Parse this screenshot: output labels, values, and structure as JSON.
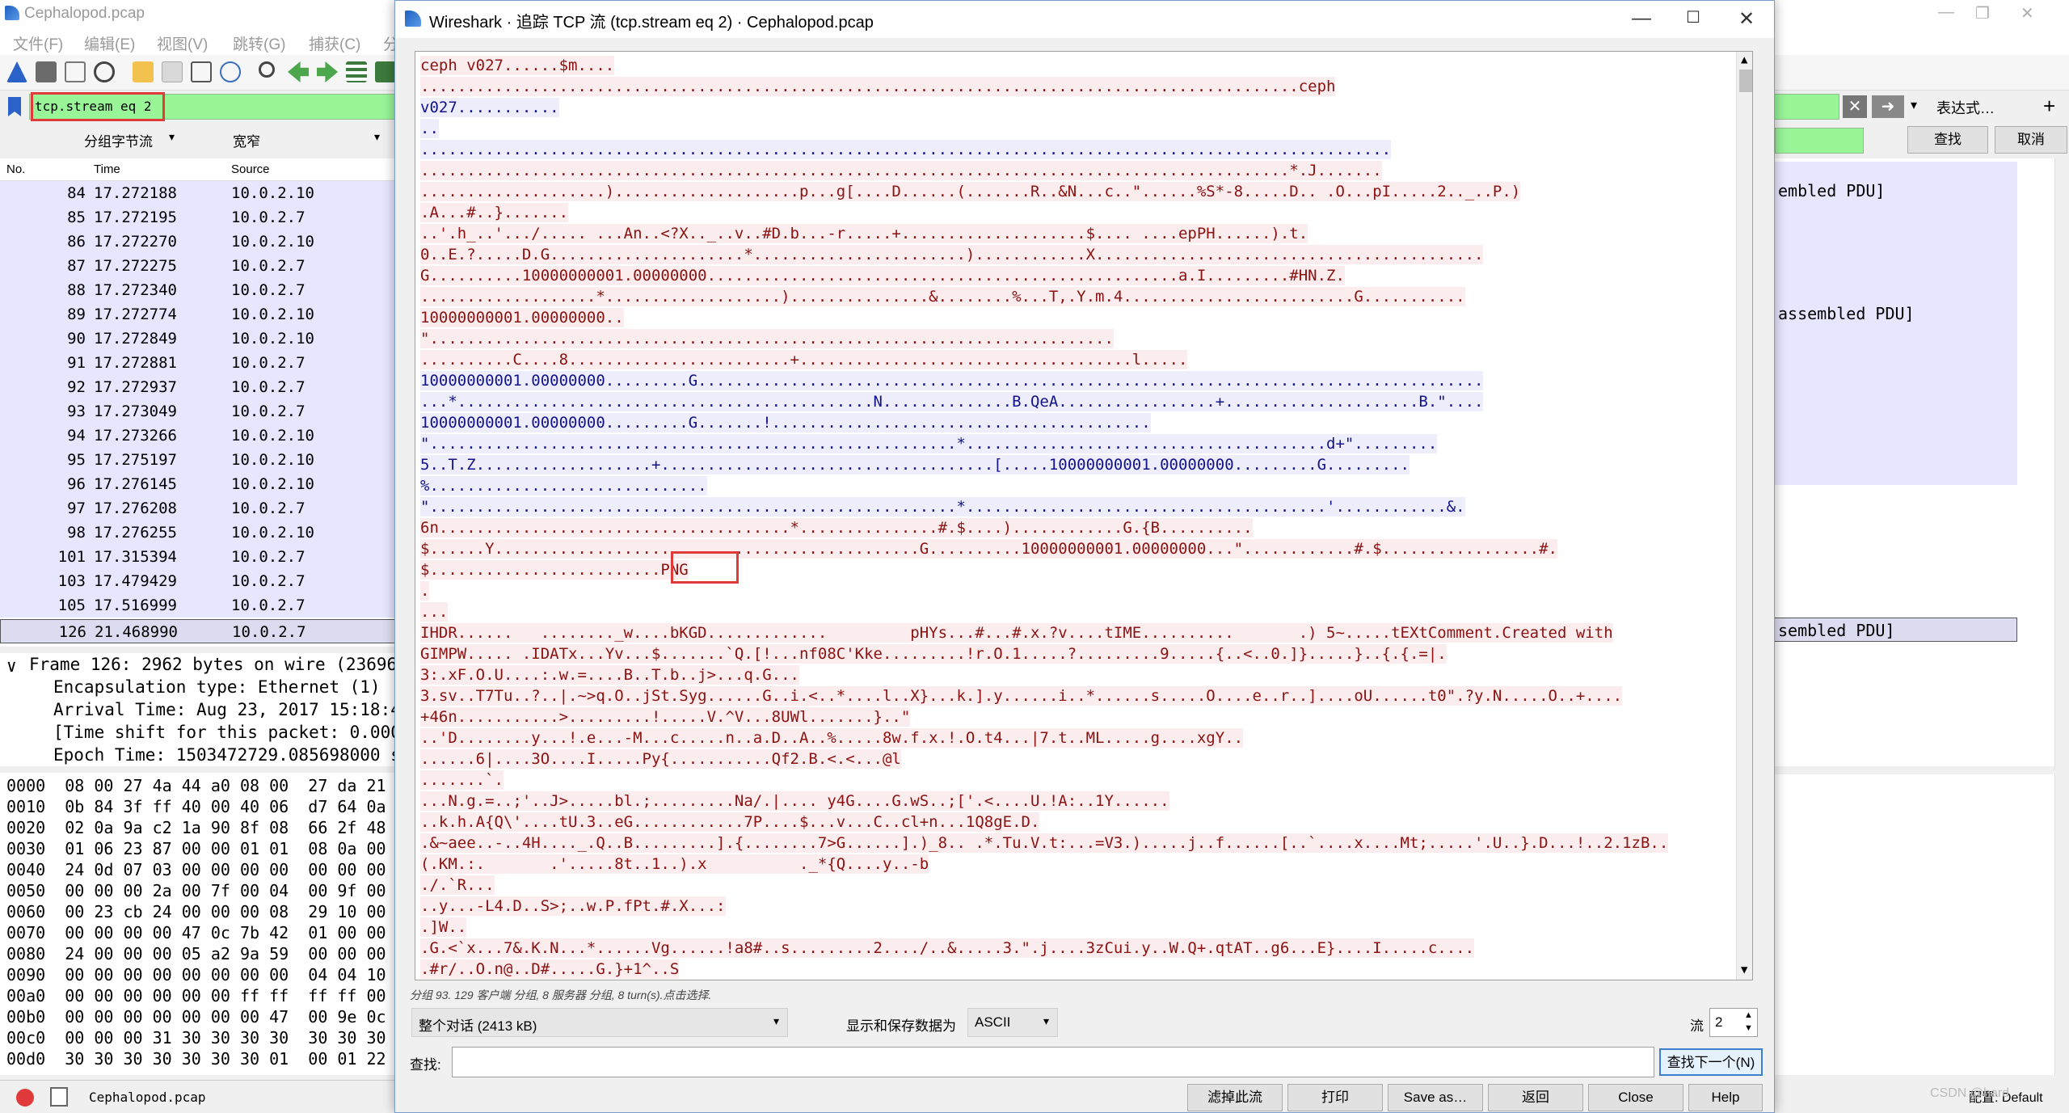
{
  "main_window": {
    "title": "Cephalopod.pcap",
    "menu": [
      "文件(F)",
      "编辑(E)",
      "视图(V)",
      "跳转(G)",
      "捕获(C)",
      "分"
    ],
    "filter": "tcp.stream eq 2",
    "expr_label": "表达式…",
    "find_btn": "查找",
    "cancel_btn": "取消",
    "search_combo_1": "分组字节流",
    "search_combo_2": "宽窄",
    "columns": {
      "no": "No.",
      "time": "Time",
      "source": "Source"
    },
    "packets": [
      {
        "no": "84",
        "time": "17.272188",
        "src": "10.0.2.10"
      },
      {
        "no": "85",
        "time": "17.272195",
        "src": "10.0.2.7"
      },
      {
        "no": "86",
        "time": "17.272270",
        "src": "10.0.2.10"
      },
      {
        "no": "87",
        "time": "17.272275",
        "src": "10.0.2.7"
      },
      {
        "no": "88",
        "time": "17.272340",
        "src": "10.0.2.7"
      },
      {
        "no": "89",
        "time": "17.272774",
        "src": "10.0.2.10"
      },
      {
        "no": "90",
        "time": "17.272849",
        "src": "10.0.2.10"
      },
      {
        "no": "91",
        "time": "17.272881",
        "src": "10.0.2.7"
      },
      {
        "no": "92",
        "time": "17.272937",
        "src": "10.0.2.7"
      },
      {
        "no": "93",
        "time": "17.273049",
        "src": "10.0.2.7"
      },
      {
        "no": "94",
        "time": "17.273266",
        "src": "10.0.2.10"
      },
      {
        "no": "95",
        "time": "17.275197",
        "src": "10.0.2.10"
      },
      {
        "no": "96",
        "time": "17.276145",
        "src": "10.0.2.10"
      },
      {
        "no": "97",
        "time": "17.276208",
        "src": "10.0.2.7"
      },
      {
        "no": "98",
        "time": "17.276255",
        "src": "10.0.2.10"
      },
      {
        "no": "101",
        "time": "17.315394",
        "src": "10.0.2.7"
      },
      {
        "no": "103",
        "time": "17.479429",
        "src": "10.0.2.7"
      },
      {
        "no": "105",
        "time": "17.516999",
        "src": "10.0.2.7"
      },
      {
        "no": "126",
        "time": "21.468990",
        "src": "10.0.2.7"
      }
    ],
    "info_fragments": [
      "embled PDU]",
      "assembled PDU]",
      "sembled PDU]"
    ],
    "details": [
      "Frame 126: 2962 bytes on wire (23696",
      "Encapsulation type: Ethernet (1)",
      "Arrival Time: Aug 23, 2017 15:18:49",
      "[Time shift for this packet: 0.0000",
      "Epoch Time: 1503472729.085698000 se"
    ],
    "hex_rows": [
      "0000  08 00 27 4a 44 a0 08 00  27 da 21",
      "0010  0b 84 3f ff 40 00 40 06  d7 64 0a",
      "0020  02 0a 9a c2 1a 90 8f 08  66 2f 48",
      "0030  01 06 23 87 00 00 01 01  08 0a 00",
      "0040  24 0d 07 03 00 00 00 00  00 00 00",
      "0050  00 00 00 2a 00 7f 00 04  00 9f 00",
      "0060  00 23 cb 24 00 00 00 08  29 10 00",
      "0070  00 00 00 00 47 0c 7b 42  01 00 00",
      "0080  24 00 00 00 05 a2 9a 59  00 00 00",
      "0090  00 00 00 00 00 00 00 00  04 04 10",
      "00a0  00 00 00 00 00 00 ff ff  ff ff 00",
      "00b0  00 00 00 00 00 00 00 47  00 9e 0c",
      "00c0  00 00 00 31 30 30 30 30  30 30 30",
      "00d0  30 30 30 30 30 30 30 01  00 01 22"
    ],
    "status_file": "Cephalopod.pcap",
    "status_right": "配置: Default",
    "watermark": "CSDN @hard"
  },
  "dialog": {
    "title": "Wireshark · 追踪 TCP 流 (tcp.stream eq 2) · Cephalopod.pcap",
    "stream_lines": [
      {
        "t": "ceph v027......$m....",
        "d": "c"
      },
      {
        "t": "...............................................................................................ceph",
        "d": "c"
      },
      {
        "t": "v027...........",
        "d": "s"
      },
      {
        "t": "..",
        "d": "s"
      },
      {
        "t": ".........................................................................................................",
        "d": "s"
      },
      {
        "t": "..............................................................................................*.J.......",
        "d": "c"
      },
      {
        "t": "....................)....................p...g[....D......(.......R..&N...c..\"......%S*-8.....D.. .O...pI.....2.._..P.)",
        "d": "c"
      },
      {
        "t": ".A...#..}.......",
        "d": "c"
      },
      {
        "t": "..'.h_..'.../..... ...An..<?X.._..v..#D.b...-r.....+....................$.... ....epPH......).t.",
        "d": "c"
      },
      {
        "t": "0..E.?.....D.G.....................*.......................)............X..........................................",
        "d": "c"
      },
      {
        "t": "G..........10000000001.00000000...................................................a.I.........#HN.Z.",
        "d": "c"
      },
      {
        "t": "...................*...................)...............&........%...T,.Y.m.4.........................G...........",
        "d": "c"
      },
      {
        "t": "10000000001.00000000..",
        "d": "c"
      },
      {
        "t": "\"..........................................................................",
        "d": "c"
      },
      {
        "t": "..........C....8........................+....................................l.....",
        "d": "c"
      },
      {
        "t": "10000000001.00000000.........G.....................................................................................",
        "d": "s"
      },
      {
        "t": "...*.............................................N..............B.QeA.................+.....................B.\"....",
        "d": "s"
      },
      {
        "t": "10000000001.00000000.........G.......!.........................................",
        "d": "s"
      },
      {
        "t": "\".........................................................*.......................................d+\".........",
        "d": "s"
      },
      {
        "t": "5..T.Z...................+....................................[.....10000000001.00000000.........G.........",
        "d": "s"
      },
      {
        "t": "%..............................",
        "d": "s"
      },
      {
        "t": "\".........................................................*.......................................'............&.",
        "d": "s"
      },
      {
        "t": "6n......................................*...............#.$....)............G.{B..........",
        "d": "c"
      },
      {
        "t": "$......Y..............................................G..........10000000001.00000000...\"............#.$.................#.",
        "d": "c"
      },
      {
        "t": "$.........................PNG",
        "d": "c"
      },
      {
        "t": ".",
        "d": "c"
      },
      {
        "t": "...",
        "d": "c"
      },
      {
        "t": "IHDR......   ........_w....bKGD.............         pHYs...#...#.x.?v....tIME..........       .) 5~.....tEXtComment.Created with",
        "d": "c"
      },
      {
        "t": "GIMPW..... .IDATx...Yv...$.......`Q.[!...nf08C'Kke.........!r.O.1.....?.........9.....{..<..0.]}.....}..{.{.=|.",
        "d": "c"
      },
      {
        "t": "3:.xF.O.U....:.w.=....B..T.b..j>...q.G...",
        "d": "c"
      },
      {
        "t": "3.sv..T7Tu..?..|.~>q.O..jSt.Syg......G..i.<..*....l..X}...k.].y......i..*......s.....O....e..r..]....oU......t0\".?y.N.....O..+....",
        "d": "c"
      },
      {
        "t": "+46n...........>.........!.....V.^V...8UWl.......}..\"",
        "d": "c"
      },
      {
        "t": "..'D........y...!.e...-M...c.....n..a.D..A..%.....8w.f.x.!.O.t4...|7.t..ML.....g....xgY..",
        "d": "c"
      },
      {
        "t": "......6|....3O....I.....Py{...........Qf2.B.<.<...@l",
        "d": "c"
      },
      {
        "t": ".......`.",
        "d": "c"
      },
      {
        "t": "...N.g.=..;'..J>.....bl.;.........Na/.|.... y4G....G.wS..;['.<....U.!A:..1Y......",
        "d": "c"
      },
      {
        "t": "..k.h.A{Q\\'....tU.3..eG............7P....$...v...C..cl+n...1Q8gE.D.",
        "d": "c"
      },
      {
        "t": ".&~aee..-..4H...._.Q..B.........].{........7>G......].)_8.. .*.Tu.V.t:...=V3.).....j..f......[..`....x....Mt;.....'.U..}.D...!..2.1zB..",
        "d": "c"
      },
      {
        "t": "(.KM.:.       .'.....8t..1..).x          ._*{Q....y..-b",
        "d": "c"
      },
      {
        "t": "./.`R...",
        "d": "c"
      },
      {
        "t": "..y...-L4.D..S>;..w.P.fPt.#.X...:",
        "d": "c"
      },
      {
        "t": ".]W..",
        "d": "c"
      },
      {
        "t": ".G.<`x...7&.K.N...*......Vg......!a8#..s.........2..../..&.....3.\".j....3zCui.y..W.Q+.qtAT..g6...E}....I.....c....",
        "d": "c"
      },
      {
        "t": ".#r/..O.n@..D#.....G.}+1^..S",
        "d": "c"
      }
    ],
    "summary": "分组 93. 129 客户端 分组, 8 服务器 分组, 8 turn(s).点击选择.",
    "conversation_combo": "整个对话 (2413 kB)",
    "show_save_label": "显示和保存数据为",
    "encoding_combo": "ASCII",
    "stream_label": "流",
    "stream_value": "2",
    "find_label": "查找:",
    "find_value": "",
    "find_next": "查找下一个(N)",
    "buttons": [
      "滤掉此流",
      "打印",
      "Save as…",
      "返回",
      "Close",
      "Help"
    ],
    "colors": {
      "client_bg": "#fbeded",
      "client_fg": "#8b1212",
      "server_bg": "#ededfb",
      "server_fg": "#12128b",
      "highlight": "#e03a3a"
    }
  }
}
